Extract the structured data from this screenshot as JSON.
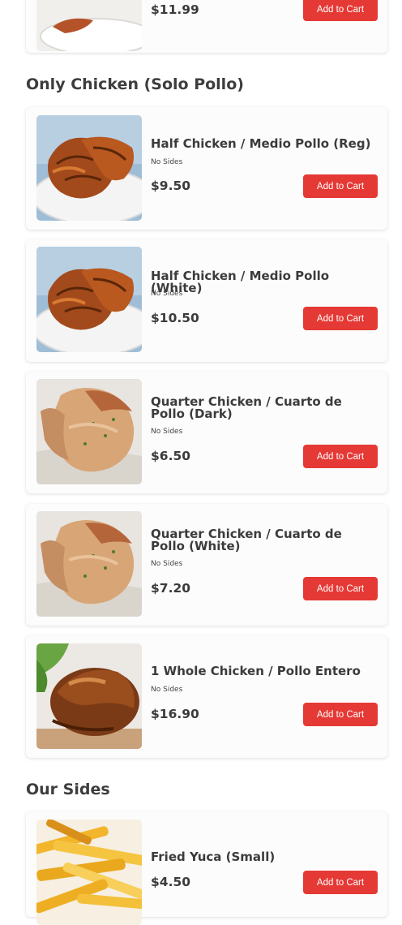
{
  "top_item": {
    "price": "$11.99",
    "button_label": "Add to Cart"
  },
  "sections": {
    "only_chicken": {
      "title": "Only Chicken (Solo Pollo)"
    },
    "our_sides": {
      "title": "Our Sides"
    }
  },
  "items": [
    {
      "name": "Half Chicken / Medio Pollo (Reg)",
      "sides": "No Sides",
      "price": "$9.50",
      "button_label": "Add to Cart",
      "image": "grilled-half-chicken"
    },
    {
      "name": "Half Chicken / Medio Pollo (White)",
      "sides": "No Sides",
      "price": "$10.50",
      "button_label": "Add to Cart",
      "image": "grilled-half-chicken"
    },
    {
      "name": "Quarter Chicken / Cuarto de Pollo (Dark)",
      "sides": "No Sides",
      "price": "$6.50",
      "button_label": "Add to Cart",
      "image": "roasted-quarter-chicken"
    },
    {
      "name": "Quarter Chicken / Cuarto de Pollo (White)",
      "sides": "No Sides",
      "price": "$7.20",
      "button_label": "Add to Cart",
      "image": "roasted-quarter-chicken"
    },
    {
      "name": "1 Whole Chicken / Pollo Entero",
      "sides": "No Sides",
      "price": "$16.90",
      "button_label": "Add to Cart",
      "image": "whole-roast-chicken"
    }
  ],
  "side_items": [
    {
      "name": "Fried Yuca (Small)",
      "price": "$4.50",
      "button_label": "Add to Cart",
      "image": "fried-yuca"
    }
  ],
  "colors": {
    "accent": "#e53935",
    "text": "#3b3b3b",
    "card_bg": "#fdfcfc"
  }
}
